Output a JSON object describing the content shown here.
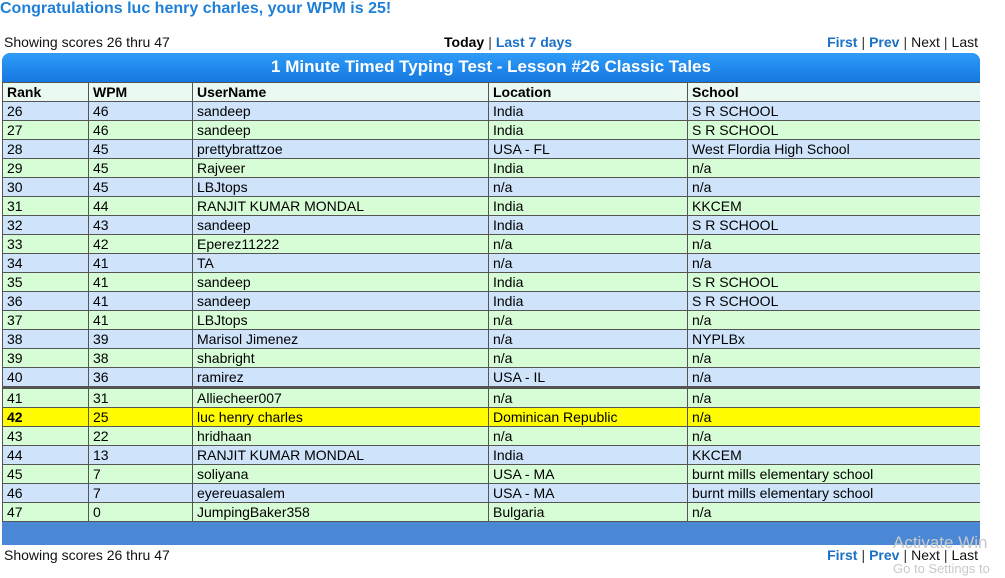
{
  "congrats": "Congratulations luc henry charles, your WPM is 25!",
  "showing": "Showing scores 26 thru 47",
  "period": {
    "today": "Today",
    "last7": "Last 7 days"
  },
  "pager": {
    "first": "First",
    "prev": "Prev",
    "next": "Next",
    "last": "Last"
  },
  "table": {
    "title": "1 Minute Timed Typing Test - Lesson #26 Classic Tales",
    "headers": [
      "Rank",
      "WPM",
      "UserName",
      "Location",
      "School"
    ],
    "rows": [
      [
        "26",
        "46",
        "sandeep",
        "India",
        "S R SCHOOL"
      ],
      [
        "27",
        "46",
        "sandeep",
        "India",
        "S R SCHOOL"
      ],
      [
        "28",
        "45",
        "prettybrattzoe",
        "USA - FL",
        "West Flordia High School"
      ],
      [
        "29",
        "45",
        "Rajveer",
        "India",
        "n/a"
      ],
      [
        "30",
        "45",
        "LBJtops",
        "n/a",
        "n/a"
      ],
      [
        "31",
        "44",
        "RANJIT KUMAR MONDAL",
        "India",
        "KKCEM"
      ],
      [
        "32",
        "43",
        "sandeep",
        "India",
        "S R SCHOOL"
      ],
      [
        "33",
        "42",
        "Eperez11222",
        "n/a",
        "n/a"
      ],
      [
        "34",
        "41",
        "TA",
        "n/a",
        "n/a"
      ],
      [
        "35",
        "41",
        "sandeep",
        "India",
        "S R SCHOOL"
      ],
      [
        "36",
        "41",
        "sandeep",
        "India",
        "S R SCHOOL"
      ],
      [
        "37",
        "41",
        "LBJtops",
        "n/a",
        "n/a"
      ],
      [
        "38",
        "39",
        "Marisol Jimenez",
        "n/a",
        "NYPLBx"
      ],
      [
        "39",
        "38",
        "shabright",
        "n/a",
        "n/a"
      ],
      [
        "40",
        "36",
        "ramirez",
        "USA - IL",
        "n/a"
      ],
      [
        "41",
        "31",
        "Alliecheer007",
        "n/a",
        "n/a"
      ],
      [
        "42",
        "25",
        "luc henry charles",
        "Dominican Republic",
        "n/a"
      ],
      [
        "43",
        "22",
        "hridhaan",
        "n/a",
        "n/a"
      ],
      [
        "44",
        "13",
        "RANJIT KUMAR MONDAL",
        "India",
        "KKCEM"
      ],
      [
        "45",
        "7",
        "soliyana",
        "USA - MA",
        "burnt mills elementary school"
      ],
      [
        "46",
        "7",
        "eyereuasalem",
        "USA - MA",
        "burnt mills elementary school"
      ],
      [
        "47",
        "0",
        "JumpingBaker358",
        "Bulgaria",
        "n/a"
      ]
    ],
    "highlight_rank": "42"
  },
  "watermark": {
    "line1": "Activate Win",
    "line2": "Go to Settings to"
  },
  "colors": {
    "link": "#1a6fc7",
    "header_top": "#2f9cf8",
    "header_bottom": "#1578e0",
    "row_blue": "#cfe4fb",
    "row_green": "#d7fdd6",
    "highlight": "#fffd00"
  }
}
